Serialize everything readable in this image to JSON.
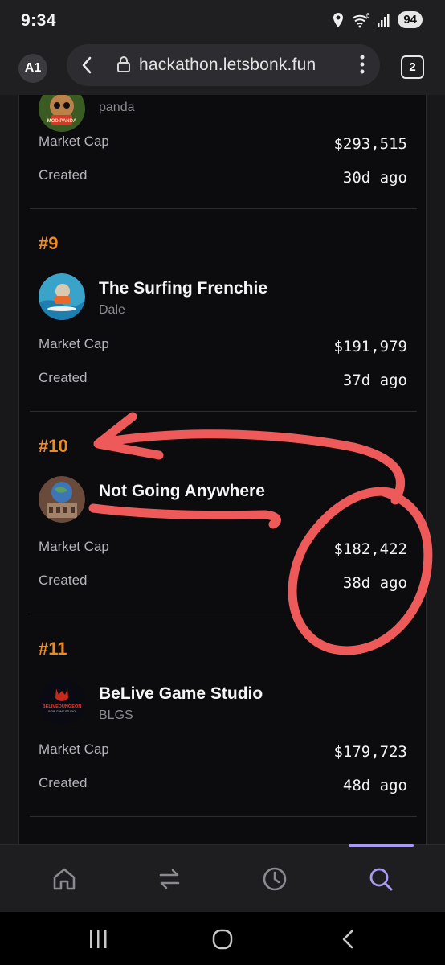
{
  "status_bar": {
    "time": "9:34",
    "battery": "94",
    "icons": [
      "location-icon",
      "wifi-6-icon",
      "signal-icon",
      "battery-icon"
    ]
  },
  "browser": {
    "profile_initials": "A1",
    "url": "hackathon.letsbonk.fun",
    "tab_count": "2",
    "icons": [
      "back-arrow-icon",
      "lock-icon",
      "menu-dots-icon"
    ]
  },
  "partial_entry": {
    "symbol": "panda",
    "avatar_text": "MOD PANDA",
    "market_cap_label": "Market Cap",
    "market_cap": "$293,515",
    "created_label": "Created",
    "created": "30d ago"
  },
  "entries": [
    {
      "rank": "#9",
      "name": "The Surfing Frenchie",
      "symbol": "Dale",
      "market_cap_label": "Market Cap",
      "market_cap": "$191,979",
      "created_label": "Created",
      "created": "37d ago"
    },
    {
      "rank": "#10",
      "name": "Not Going Anywhere",
      "symbol": "",
      "market_cap_label": "Market Cap",
      "market_cap": "$182,422",
      "created_label": "Created",
      "created": "38d ago"
    },
    {
      "rank": "#11",
      "name": "BeLive Game Studio",
      "symbol": "BLGS",
      "avatar_text": "BELIVEDUNGEON",
      "avatar_subtext": "INDIE GAME STUDIO",
      "market_cap_label": "Market Cap",
      "market_cap": "$179,723",
      "created_label": "Created",
      "created": "48d ago"
    }
  ],
  "bottom_nav": {
    "items": [
      "home-icon",
      "swap-icon",
      "history-icon",
      "search-icon"
    ],
    "active": "search-icon"
  },
  "system_nav": {
    "items": [
      "recents-icon",
      "home-circle-icon",
      "back-icon"
    ]
  },
  "colors": {
    "rank": "#ef8a22",
    "annotation": "#ee5a5a",
    "active_nav": "#a89af0",
    "background": "#0c0c0e"
  }
}
